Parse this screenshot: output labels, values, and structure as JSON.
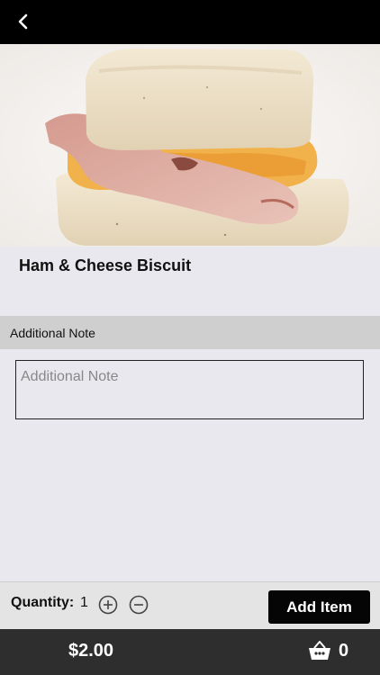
{
  "header": {
    "back_icon": "chevron-left-icon"
  },
  "product": {
    "image_alt": "Ham & Cheese Biscuit photo",
    "title": "Ham & Cheese Biscuit"
  },
  "note": {
    "section_label": "Additional Note",
    "placeholder": "Additional Note",
    "value": ""
  },
  "quantity": {
    "label": "Quantity:",
    "value": "1",
    "increase_icon": "plus-circle-icon",
    "decrease_icon": "minus-circle-icon"
  },
  "actions": {
    "add_label": "Add Item"
  },
  "footer": {
    "price": "$2.00",
    "cart_icon": "basket-icon",
    "cart_count": "0"
  },
  "colors": {
    "topbar": "#000000",
    "background": "#e9e8ef",
    "section_header": "#cfcfcf",
    "add_button": "#050505",
    "footer": "#2e2e2e"
  }
}
